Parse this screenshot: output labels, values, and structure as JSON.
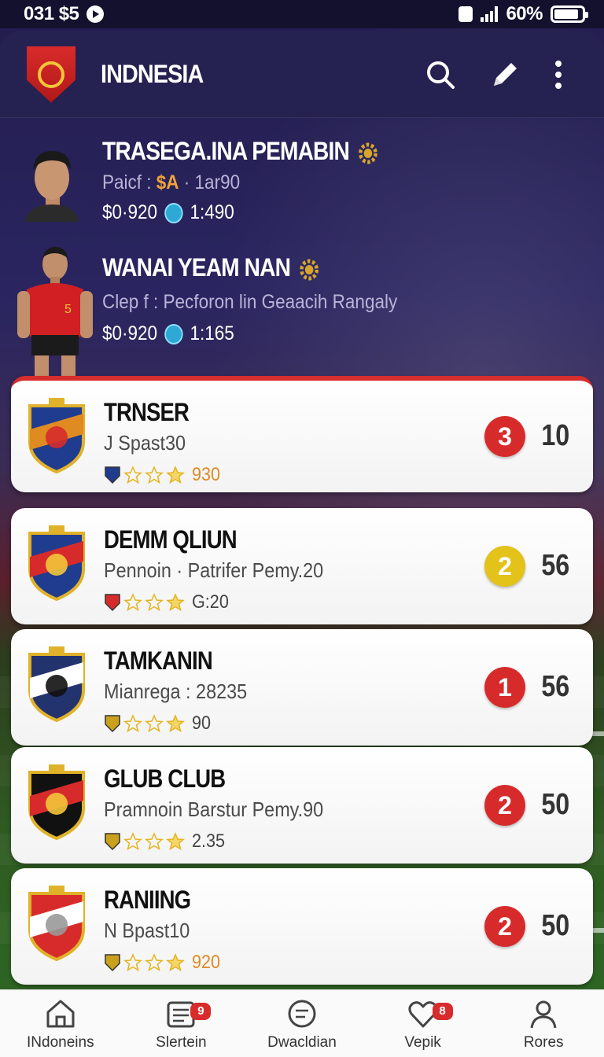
{
  "status_bar": {
    "time": "031 $5",
    "battery": "60%"
  },
  "header": {
    "title": "INDNESIA"
  },
  "players": [
    {
      "name": "TRASEGA.INA PEMABIN",
      "sub_prefix": "Paicf : ",
      "sub_highlight": "$A",
      "sub_suffix": " · 1ar90",
      "price": "$0·920",
      "stat": "1:490"
    },
    {
      "name": "WANAI YEAM NAN",
      "sub_prefix": "Clep f  : ",
      "sub_highlight": "",
      "sub_suffix": "Pecforon lin Geaacih Rangaly",
      "price": "$0·920",
      "stat": "1:165"
    }
  ],
  "teams": [
    {
      "name": "TRNSER",
      "desc": "Spast30",
      "desc_prefix": "J",
      "value": "930",
      "value_color": "orange",
      "rank": "3",
      "rank_color": "#d72b2b",
      "points": "10",
      "crest_colors": [
        "#1f3c8f",
        "#e08a22",
        "#d72b2b"
      ]
    },
    {
      "name": "DEMM QLIUN",
      "desc": "Pennoin · Patrifer Pemy.20",
      "desc_prefix": "",
      "value": "G:20",
      "value_color": "gray",
      "rank": "2",
      "rank_color": "#e3c21a",
      "points": "56",
      "crest_colors": [
        "#1f3c8f",
        "#d72b2b",
        "#f3c53a"
      ]
    },
    {
      "name": "TAMKANIN",
      "desc": "Mianrega : 28235",
      "desc_prefix": "",
      "value": "90",
      "value_color": "gray",
      "rank": "1",
      "rank_color": "#d72b2b",
      "points": "56",
      "crest_colors": [
        "#23336e",
        "#ffffff",
        "#111111"
      ]
    },
    {
      "name": "GLUB CLUB",
      "desc": "Pramnoin Barstur Pemy.90",
      "desc_prefix": "",
      "value": "2.35",
      "value_color": "gray",
      "rank": "2",
      "rank_color": "#d72b2b",
      "points": "50",
      "crest_colors": [
        "#111111",
        "#d72b2b",
        "#f3c53a"
      ]
    },
    {
      "name": "RANIING",
      "desc": "Bpast10",
      "desc_prefix": "N",
      "value": "920",
      "value_color": "orange",
      "rank": "2",
      "rank_color": "#d72b2b",
      "points": "50",
      "crest_colors": [
        "#d72b2b",
        "#ffffff",
        "#999999"
      ]
    }
  ],
  "nav": [
    {
      "label": "INdoneins",
      "icon": "home-icon",
      "badge": ""
    },
    {
      "label": "Slertein",
      "icon": "list-icon",
      "badge": "9"
    },
    {
      "label": "Dwacldian",
      "icon": "chat-icon",
      "badge": ""
    },
    {
      "label": "Vepik",
      "icon": "heart-icon",
      "badge": "8"
    },
    {
      "label": "Rores",
      "icon": "profile-icon",
      "badge": ""
    }
  ]
}
